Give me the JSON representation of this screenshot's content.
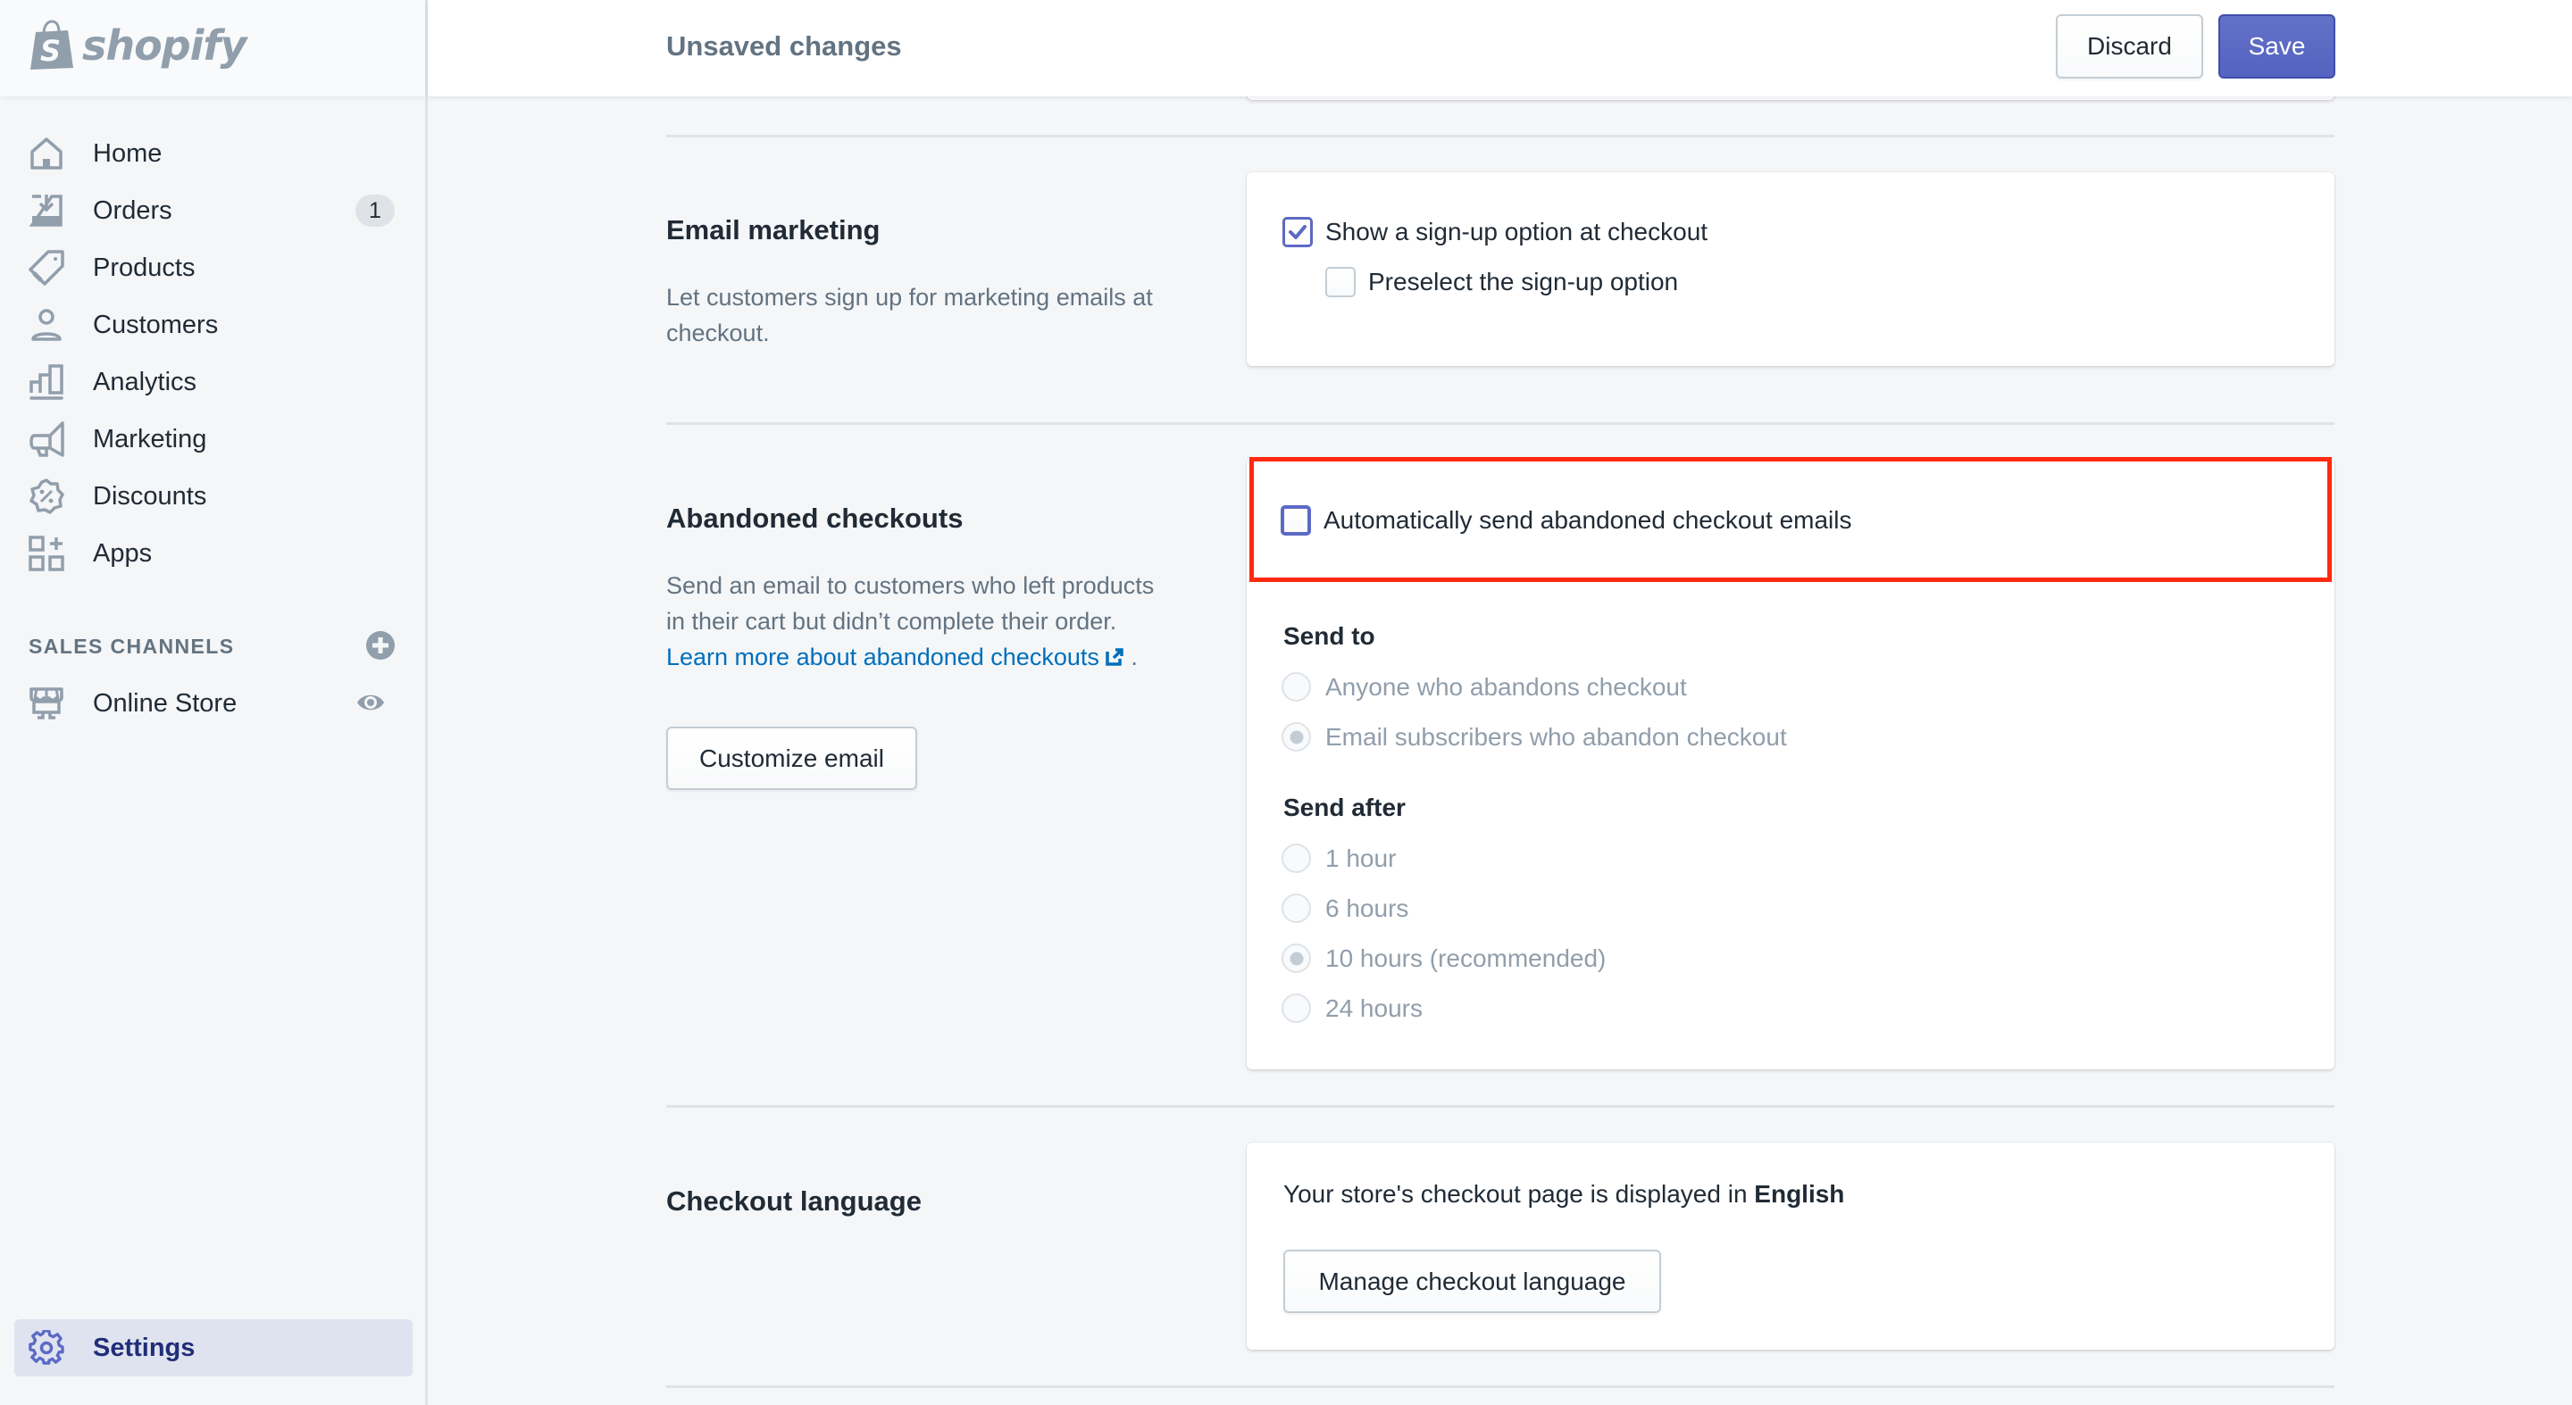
{
  "brand": {
    "name": "shopify"
  },
  "sidebar": {
    "items": [
      {
        "label": "Home",
        "icon": "home-icon"
      },
      {
        "label": "Orders",
        "icon": "orders-icon",
        "badge": "1"
      },
      {
        "label": "Products",
        "icon": "tag-icon"
      },
      {
        "label": "Customers",
        "icon": "person-icon"
      },
      {
        "label": "Analytics",
        "icon": "bar-chart-icon"
      },
      {
        "label": "Marketing",
        "icon": "megaphone-icon"
      },
      {
        "label": "Discounts",
        "icon": "discount-icon"
      },
      {
        "label": "Apps",
        "icon": "apps-icon"
      }
    ],
    "sales_channels": {
      "title": "SALES CHANNELS",
      "items": [
        {
          "label": "Online Store",
          "icon": "store-icon"
        }
      ]
    },
    "settings": {
      "label": "Settings",
      "icon": "gear-icon",
      "active": true
    }
  },
  "topbar": {
    "title": "Unsaved changes",
    "discard_label": "Discard",
    "save_label": "Save"
  },
  "sections": {
    "email_marketing": {
      "title": "Email marketing",
      "description": "Let customers sign up for marketing emails at checkout.",
      "options": [
        {
          "label": "Show a sign-up option at checkout",
          "checked": true
        },
        {
          "label": "Preselect the sign-up option",
          "checked": false
        }
      ]
    },
    "abandoned_checkouts": {
      "title": "Abandoned checkouts",
      "description": "Send an email to customers who left products in their cart but didn’t complete their order.",
      "link_text": "Learn more about abandoned checkouts",
      "link_suffix": ".",
      "customize_button": "Customize email",
      "auto_send": {
        "label": "Automatically send abandoned checkout emails",
        "checked": false,
        "highlighted": true
      },
      "send_to": {
        "title": "Send to",
        "options": [
          {
            "label": "Anyone who abandons checkout",
            "selected": false,
            "disabled": true
          },
          {
            "label": "Email subscribers who abandon checkout",
            "selected": true,
            "disabled": true
          }
        ]
      },
      "send_after": {
        "title": "Send after",
        "options": [
          {
            "label": "1 hour",
            "selected": false,
            "disabled": true
          },
          {
            "label": "6 hours",
            "selected": false,
            "disabled": true
          },
          {
            "label": "10 hours (recommended)",
            "selected": true,
            "disabled": true
          },
          {
            "label": "24 hours",
            "selected": false,
            "disabled": true
          }
        ]
      }
    },
    "checkout_language": {
      "title": "Checkout language",
      "text_prefix": "Your store's checkout page is displayed in ",
      "language": "English",
      "manage_button": "Manage checkout language"
    }
  },
  "colors": {
    "accent": "#5c6ac4",
    "link": "#006fbb",
    "highlight_box": "#ff2a0f",
    "active_nav_bg": "#dfe3f0"
  }
}
